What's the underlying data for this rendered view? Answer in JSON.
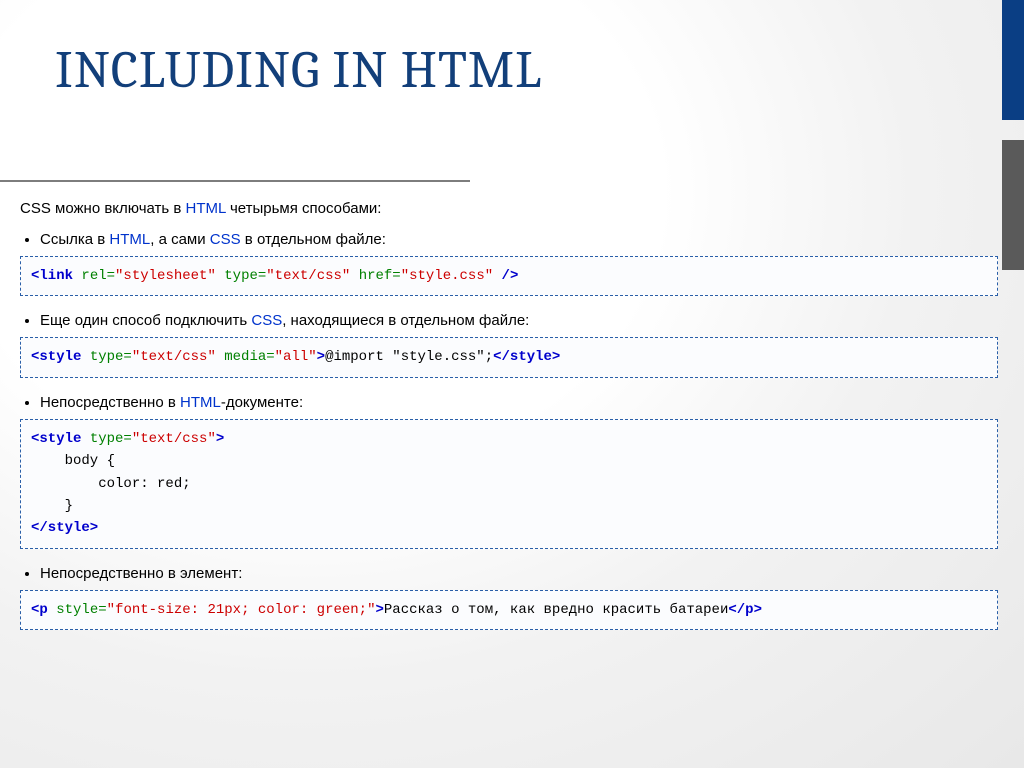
{
  "title": "INCLUDING IN HTML",
  "intro_pre": "CSS можно включать в ",
  "intro_link": "HTML",
  "intro_post": " четырьмя способами:",
  "items": [
    {
      "bullet_pre": "Ссылка в ",
      "bullet_link1": "HTML",
      "bullet_mid": ", а сами ",
      "bullet_link2": "CSS",
      "bullet_post": " в отдельном файле:",
      "code": {
        "p1": "<link ",
        "p2": "rel=",
        "p3": "\"stylesheet\"",
        "p4": " type=",
        "p5": "\"text/css\"",
        "p6": " href=",
        "p7": "\"style.css\"",
        "p8": " />"
      }
    },
    {
      "bullet_pre": "Еще один способ подключить ",
      "bullet_link1": "CSS",
      "bullet_post": ", находящиеся в отдельном файле:",
      "code": {
        "p1": "<style ",
        "p2": "type=",
        "p3": "\"text/css\"",
        "p4": " media=",
        "p5": "\"all\"",
        "p6": ">",
        "p7": "@import \"style.css\";",
        "p8": "</style>"
      }
    },
    {
      "bullet_pre": "Непосредственно в ",
      "bullet_link1": "HTML",
      "bullet_post": "-документе:",
      "code": {
        "l1a": "<style ",
        "l1b": "type=",
        "l1c": "\"text/css\"",
        "l1d": ">",
        "l2": "    body {",
        "l3": "        color: red;",
        "l4": "    }",
        "l5": "</style>"
      }
    },
    {
      "bullet_pre": "Непосредственно в элемент:",
      "code": {
        "p1": "<p ",
        "p2": "style=",
        "p3": "\"font-size: 21px; color: green;\"",
        "p4": ">",
        "p5": "Рассказ о том, как вредно красить батареи",
        "p6": "</p>"
      }
    }
  ]
}
